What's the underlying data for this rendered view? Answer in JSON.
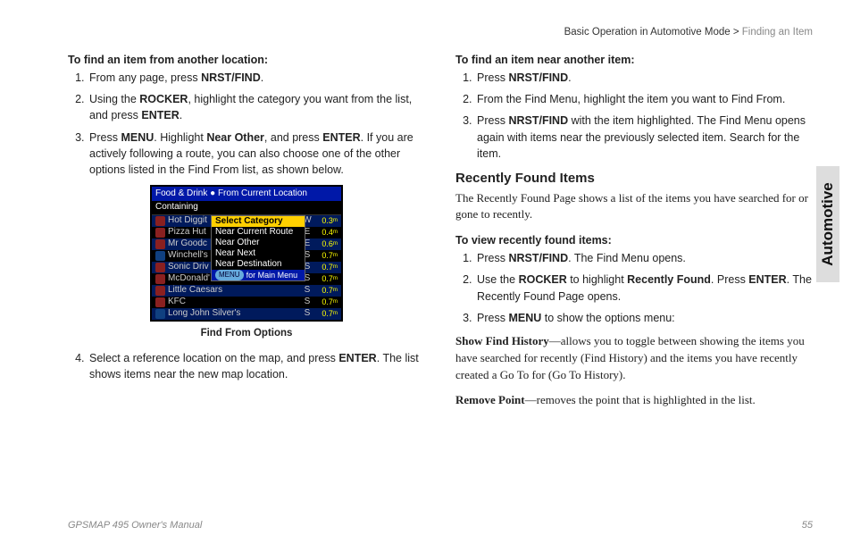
{
  "breadcrumb": {
    "main": "Basic Operation in Automotive Mode > ",
    "sub": "Finding an Item"
  },
  "sidetab": "Automotive",
  "footer": {
    "manual": "GPSMAP 495 Owner's Manual",
    "page": "55"
  },
  "left": {
    "lead": "To find an item from another location:",
    "step1_a": "From any page, press ",
    "step1_b": "NRST/FIND",
    "step1_c": ".",
    "step2_a": "Using the ",
    "step2_b": "ROCKER",
    "step2_c": ", highlight the category you want from the list, and press ",
    "step2_d": "ENTER",
    "step2_e": ".",
    "step3_a": "Press ",
    "step3_b": "MENU",
    "step3_c": ". Highlight ",
    "step3_d": "Near Other",
    "step3_e": ", and press ",
    "step3_f": "ENTER",
    "step3_g": ". If you are actively following a route, you can also choose one of the other options listed in the Find From list, as shown below.",
    "caption": "Find From Options",
    "step4_a": "Select a reference location on the map, and press ",
    "step4_b": "ENTER",
    "step4_c": ". The list shows items near the new map location."
  },
  "screenshot": {
    "title": "Food & Drink ● From Current Location",
    "containing": "Containing",
    "popup": {
      "o1": "Select Category",
      "o2": "Near Current Route",
      "o3": "Near Other",
      "o4": "Near Next",
      "o5": "Near Destination"
    },
    "menuhint_pill": "MENU",
    "menuhint_text": "for Main Menu",
    "rows": [
      {
        "name": "Hot Diggit",
        "dir": "W",
        "dist": "0.3ᵐ"
      },
      {
        "name": "Pizza Hut",
        "dir": "E",
        "dist": "0.4ᵐ"
      },
      {
        "name": "Mr Goodc",
        "dir": "E",
        "dist": "0.6ᵐ"
      },
      {
        "name": "Winchell's",
        "dir": "S",
        "dist": "0.7ᵐ"
      },
      {
        "name": "Sonic Driv",
        "dir": "S",
        "dist": "0.7ᵐ"
      },
      {
        "name": "McDonald'",
        "dir": "S",
        "dist": "0.7ᵐ"
      },
      {
        "name": "Little Caesars",
        "dir": "S",
        "dist": "0.7ᵐ"
      },
      {
        "name": "KFC",
        "dir": "S",
        "dist": "0.7ᵐ"
      },
      {
        "name": "Long John Silver's",
        "dir": "S",
        "dist": "0.7ᵐ"
      }
    ]
  },
  "right": {
    "lead": "To find an item near another item:",
    "s1_a": "Press ",
    "s1_b": "NRST/FIND",
    "s1_c": ".",
    "s2": "From the Find Menu, highlight the item you want to Find From.",
    "s3_a": "Press ",
    "s3_b": "NRST/FIND",
    "s3_c": " with the item highlighted. The Find Menu opens again with items near the previously selected item. Search for the item.",
    "h3": "Recently Found Items",
    "p1": "The Recently Found Page shows a list of the items you have searched for or gone to recently.",
    "lead2": "To view recently found items:",
    "v1_a": "Press ",
    "v1_b": "NRST/FIND",
    "v1_c": ". The Find Menu opens.",
    "v2_a": "Use the ",
    "v2_b": "ROCKER",
    "v2_c": " to highlight ",
    "v2_d": "Recently Found",
    "v2_e": ". Press ",
    "v2_f": "ENTER",
    "v2_g": ". The Recently Found Page opens.",
    "v3_a": "Press ",
    "v3_b": "MENU",
    "v3_c": " to show the options menu:",
    "p2_b": "Show Find History",
    "p2_t": "—allows you to toggle between showing the items you have searched for recently (Find History) and the items you have recently created a Go To for (Go To History).",
    "p3_b": "Remove Point",
    "p3_t": "—removes the point that is highlighted in the list."
  }
}
